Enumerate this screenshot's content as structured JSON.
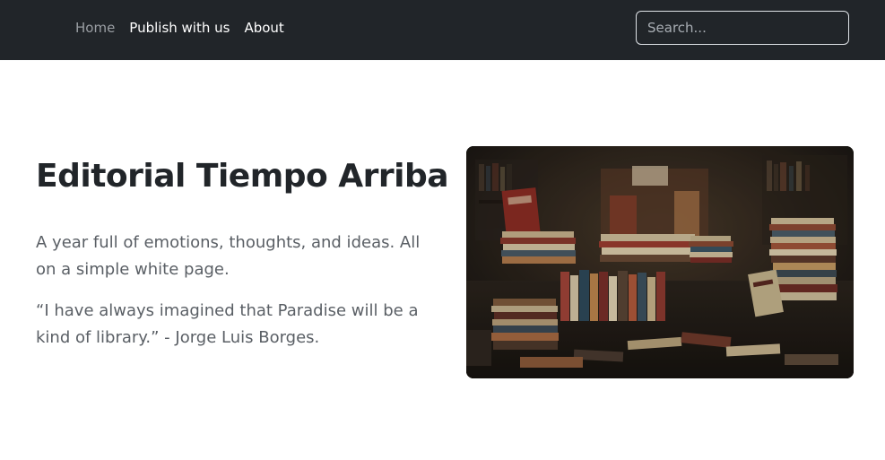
{
  "nav": {
    "links": [
      {
        "label": "Home",
        "active": false
      },
      {
        "label": "Publish with us",
        "active": true
      },
      {
        "label": "About",
        "active": true
      }
    ],
    "search": {
      "placeholder": "Search...",
      "value": ""
    }
  },
  "hero": {
    "title": "Editorial Tiempo Arriba",
    "paragraph1": "A year full of emotions, thoughts, and ideas. All on a simple white page.",
    "paragraph2": "“I have always imagined that Paradise will be a kind of library.” - Jorge Luis Borges.",
    "image": {
      "subject": "stacks of books in a bookstore"
    }
  },
  "colors": {
    "navbar_bg": "#212529",
    "nav_link": "#ffffff",
    "nav_link_muted": "#9a9ea3",
    "title": "#212529",
    "body_text": "#5a5f65"
  }
}
